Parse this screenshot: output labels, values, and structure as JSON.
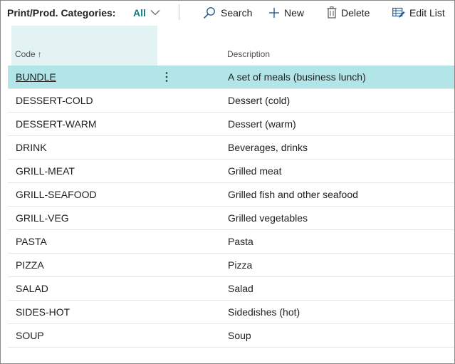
{
  "actionbar": {
    "title": "Print/Prod. Categories:",
    "filter_label": "All",
    "search_label": "Search",
    "new_label": "New",
    "delete_label": "Delete",
    "edit_list_label": "Edit List"
  },
  "columns": {
    "code": "Code",
    "code_sort_indicator": "↑",
    "description": "Description"
  },
  "rows": [
    {
      "code": "BUNDLE",
      "description": "A set of meals (business lunch)",
      "selected": true
    },
    {
      "code": "DESSERT-COLD",
      "description": "Dessert (cold)"
    },
    {
      "code": "DESSERT-WARM",
      "description": "Dessert (warm)"
    },
    {
      "code": "DRINK",
      "description": "Beverages, drinks"
    },
    {
      "code": "GRILL-MEAT",
      "description": "Grilled meat"
    },
    {
      "code": "GRILL-SEAFOOD",
      "description": "Grilled fish and other seafood"
    },
    {
      "code": "GRILL-VEG",
      "description": "Grilled vegetables"
    },
    {
      "code": "PASTA",
      "description": "Pasta"
    },
    {
      "code": "PIZZA",
      "description": "Pizza"
    },
    {
      "code": "SALAD",
      "description": "Salad"
    },
    {
      "code": "SIDES-HOT",
      "description": "Sidedishes (hot)"
    },
    {
      "code": "SOUP",
      "description": "Soup"
    }
  ],
  "colors": {
    "accent": "#0f7c82",
    "selected_row": "#b2e5e8",
    "header_highlight": "#e3f3f4"
  },
  "icons": {
    "filter": "chevron-down-icon",
    "search": "search-icon",
    "new": "plus-icon",
    "delete": "trash-icon",
    "edit_list": "edit-list-icon",
    "row_menu": "more-vertical-icon"
  }
}
